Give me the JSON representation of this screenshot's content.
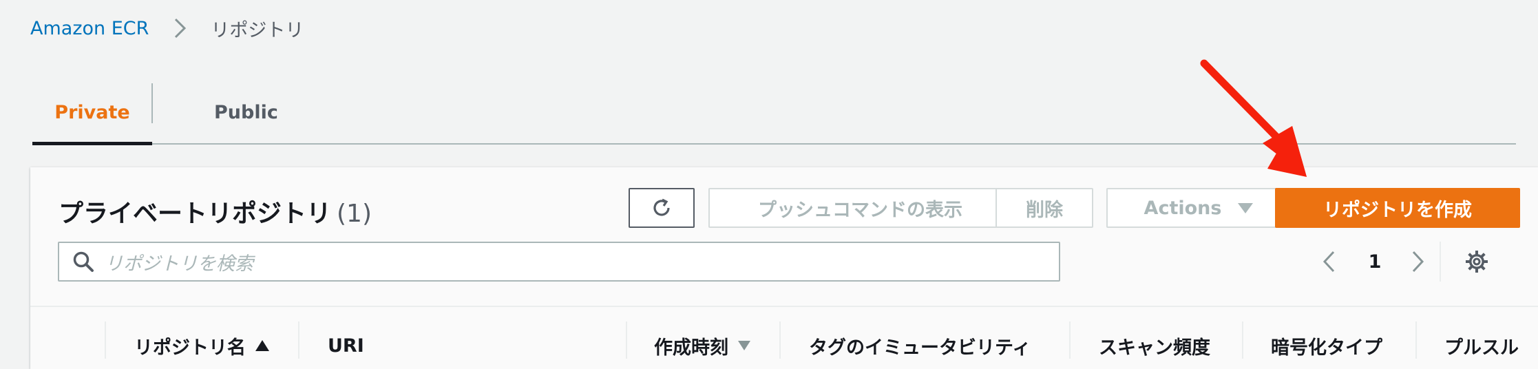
{
  "breadcrumb": {
    "root": "Amazon ECR",
    "current": "リポジトリ"
  },
  "tabs": [
    {
      "label": "Private",
      "active": true
    },
    {
      "label": "Public",
      "active": false
    }
  ],
  "panel": {
    "title": "プライベートリポジトリ",
    "count": "(1)"
  },
  "toolbar": {
    "push_commands_label": "プッシュコマンドの表示",
    "delete_label": "削除",
    "actions_label": "Actions",
    "create_label": "リポジトリを作成"
  },
  "search": {
    "placeholder": "リポジトリを検索"
  },
  "pagination": {
    "current_page": "1"
  },
  "table": {
    "columns": [
      "リポジトリ名",
      "URI",
      "作成時刻",
      "タグのイミュータビリティ",
      "スキャン頻度",
      "暗号化タイプ",
      "プルスル"
    ]
  },
  "colors": {
    "accent": "#ec7211",
    "link": "#0073bb",
    "annotation_arrow": "#f5210c"
  },
  "icons": [
    "chevron-right-icon",
    "refresh-icon",
    "caret-down-icon",
    "search-icon",
    "chevron-left-icon",
    "gear-icon",
    "sort-ascending-icon",
    "sort-descending-icon",
    "red-annotation-arrow"
  ]
}
